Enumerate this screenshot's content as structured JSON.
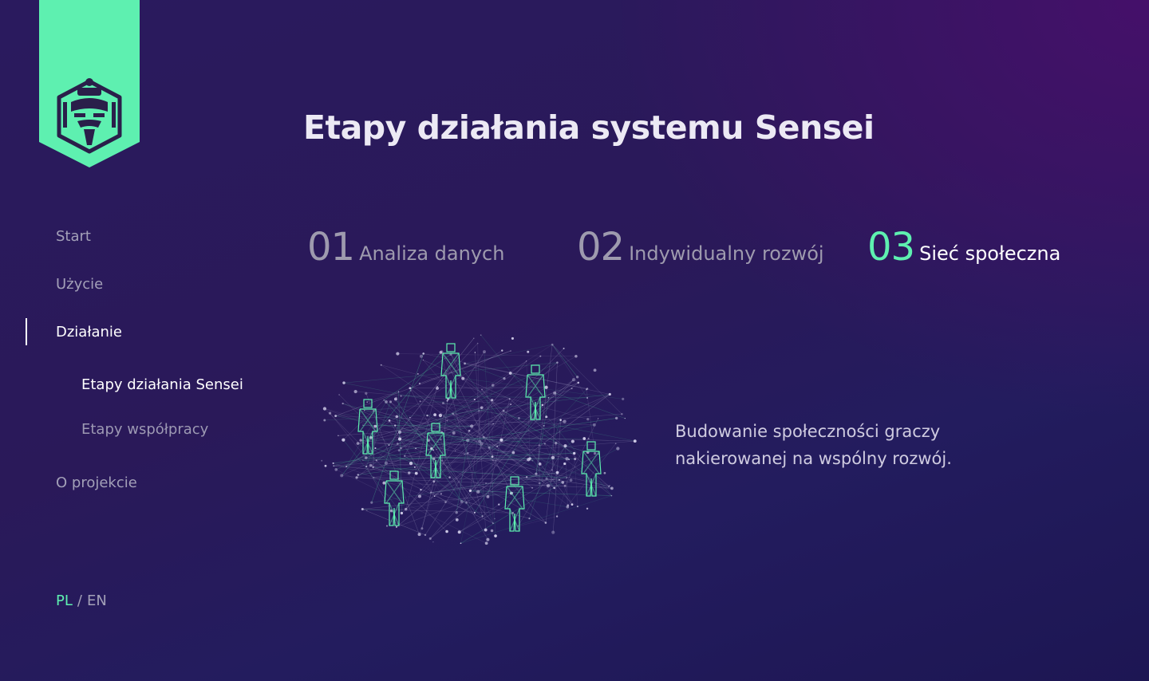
{
  "brand": {
    "logo_icon": "sensei-mask-icon",
    "accent_color": "#5ef0b0"
  },
  "page_title": "Etapy działania systemu Sensei",
  "nav": {
    "items": [
      {
        "label": "Start"
      },
      {
        "label": "Użycie"
      },
      {
        "label": "Działanie",
        "active": true
      },
      {
        "label": "O projekcie"
      }
    ],
    "subitems": [
      {
        "label": "Etapy działania Sensei",
        "active": true
      },
      {
        "label": "Etapy współpracy"
      }
    ]
  },
  "language": {
    "pl": "PL",
    "separator": "/",
    "en": "EN",
    "active": "PL"
  },
  "steps": [
    {
      "number": "01",
      "label": "Analiza danych"
    },
    {
      "number": "02",
      "label": "Indywidualny rozwój"
    },
    {
      "number": "03",
      "label": "Sieć społeczna",
      "active": true
    }
  ],
  "description": "Budowanie społeczności graczy nakierowanej na wspólny rozwój.",
  "illustration_icon": "social-network-people-illustration"
}
